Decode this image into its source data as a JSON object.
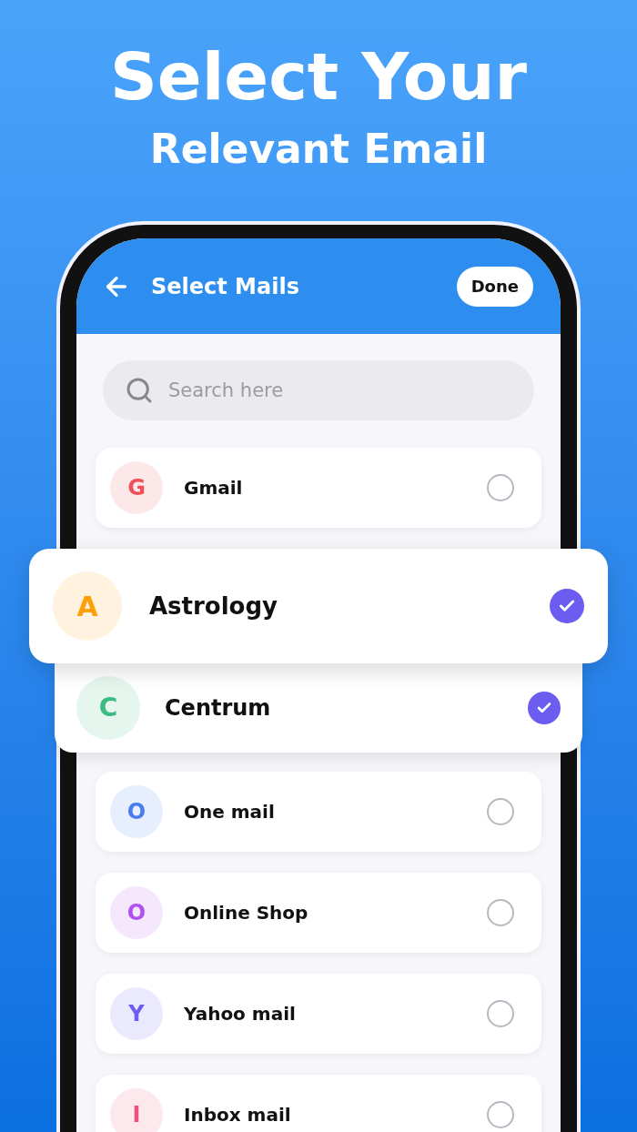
{
  "headline": {
    "title": "Select Your",
    "subtitle": "Relevant Email"
  },
  "app_bar": {
    "title": "Select Mails",
    "done_button": "Done"
  },
  "search": {
    "placeholder": "Search here"
  },
  "mails": [
    {
      "kind": "card",
      "letter": "G",
      "name": "Gmail",
      "color": "#f0505a",
      "selected": false
    },
    {
      "kind": "featured",
      "letter": "A",
      "name": "Astrology",
      "color": "#ff9f0a",
      "selected": true
    },
    {
      "kind": "expanded",
      "letter": "C",
      "name": "Centrum",
      "color": "#3dbb85",
      "selected": true
    },
    {
      "kind": "card",
      "letter": "O",
      "name": "One mail",
      "color": "#4a7cf0",
      "selected": false
    },
    {
      "kind": "card",
      "letter": "O",
      "name": "Online Shop",
      "color": "#b150f0",
      "selected": false
    },
    {
      "kind": "card",
      "letter": "Y",
      "name": "Yahoo mail",
      "color": "#6c5cf0",
      "selected": false
    },
    {
      "kind": "card",
      "letter": "I",
      "name": "Inbox mail",
      "color": "#f0507a",
      "selected": false
    }
  ]
}
